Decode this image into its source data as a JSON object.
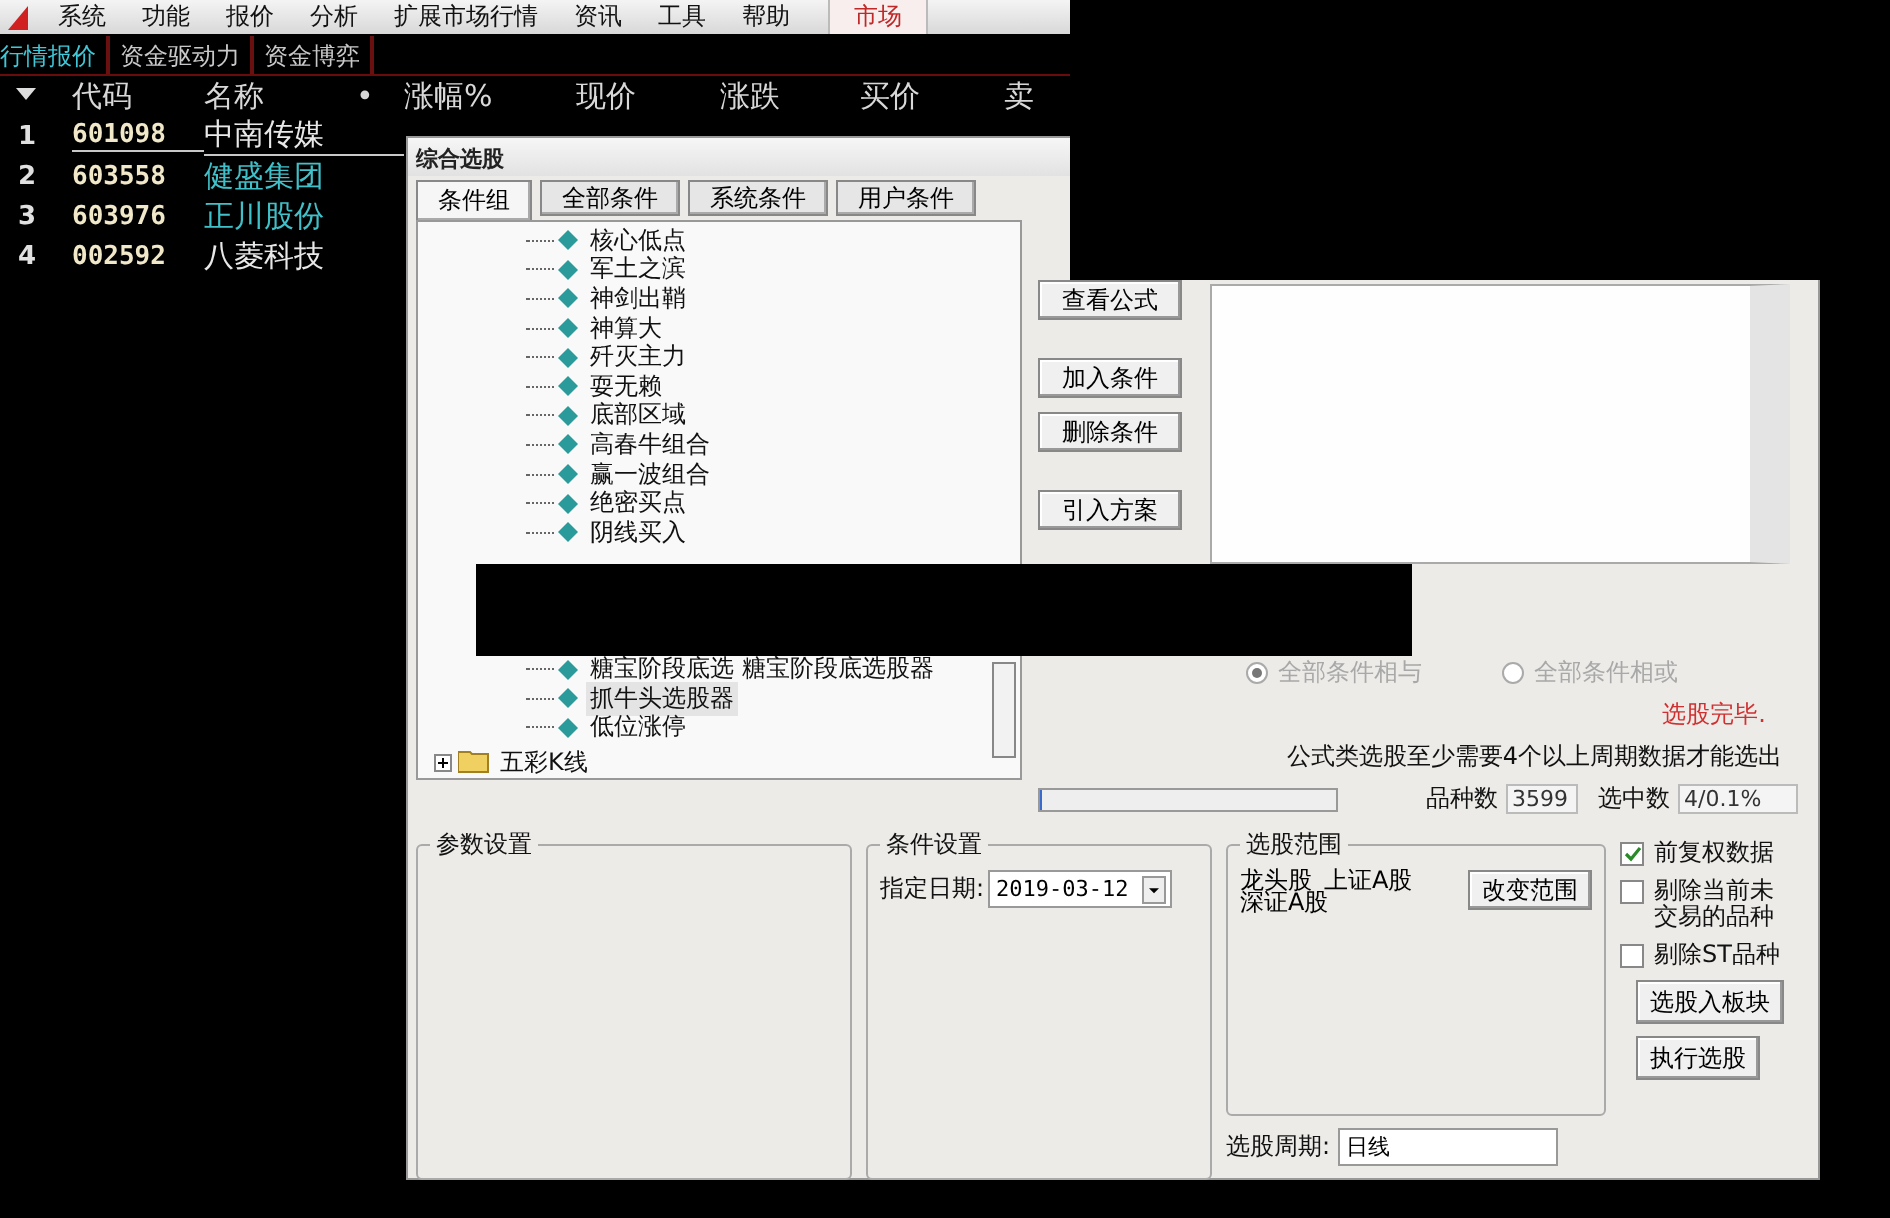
{
  "menu": [
    {
      "label": "系统"
    },
    {
      "label": "功能"
    },
    {
      "label": "报价"
    },
    {
      "label": "分析"
    },
    {
      "label": "扩展市场行情"
    },
    {
      "label": "资讯"
    },
    {
      "label": "工具"
    },
    {
      "label": "帮助"
    }
  ],
  "market_tab": {
    "label": "市场",
    "selected": true
  },
  "sub_tabs": [
    {
      "label": "行情报价",
      "selected": true
    },
    {
      "label": "资金驱动力",
      "selected": false
    },
    {
      "label": "资金博弈",
      "selected": false
    }
  ],
  "table": {
    "columns": [
      "代码",
      "名称",
      "•",
      "涨幅%",
      "现价",
      "涨跌",
      "买价",
      "卖"
    ],
    "rows": [
      {
        "index": "1",
        "code": "601098",
        "name": "中南传媒",
        "color": "#e8e8e8",
        "selected": true
      },
      {
        "index": "2",
        "code": "603558",
        "name": "健盛集团",
        "color": "#40c0c8",
        "selected": false
      },
      {
        "index": "3",
        "code": "603976",
        "name": "正川股份",
        "color": "#40c0c8",
        "selected": false
      },
      {
        "index": "4",
        "code": "002592",
        "name": "八菱科技",
        "color": "#e8e8e8",
        "selected": false
      }
    ]
  },
  "dialog": {
    "title": "综合选股",
    "tabs": [
      {
        "label": "条件组",
        "selected": true
      },
      {
        "label": "全部条件",
        "selected": false
      },
      {
        "label": "系统条件",
        "selected": false
      },
      {
        "label": "用户条件",
        "selected": false
      }
    ],
    "tree": {
      "leaves_top": [
        {
          "label": "核心低点",
          "selected": false
        },
        {
          "label": "军土之滨",
          "selected": false
        },
        {
          "label": "神剑出鞘",
          "selected": false
        },
        {
          "label": "神算大",
          "selected": false
        },
        {
          "label": "歼灭主力",
          "selected": false
        },
        {
          "label": "耍无赖",
          "selected": false
        },
        {
          "label": "底部区域",
          "selected": false
        },
        {
          "label": "高春牛组合",
          "selected": false
        },
        {
          "label": "赢一波组合",
          "selected": false
        },
        {
          "label": "绝密买点",
          "selected": false
        },
        {
          "label": "阴线买入",
          "selected": false
        }
      ],
      "leaves_bottom": [
        {
          "label": "糖宝阶段底选  糖宝阶段底选股器",
          "selected": false
        },
        {
          "label": "抓牛头选股器",
          "selected": true
        },
        {
          "label": "低位涨停",
          "selected": false
        }
      ],
      "folders": [
        {
          "label": "五彩K线",
          "expanded": false
        }
      ]
    },
    "side_buttons": [
      "查看公式",
      "加入条件",
      "删除条件",
      "引入方案"
    ],
    "logic": {
      "disabled": true,
      "options": [
        {
          "label": "全部条件相与",
          "selected": true
        },
        {
          "label": "全部条件相或",
          "selected": false
        }
      ]
    },
    "status": "选股完毕.",
    "note": "公式类选股至少需要4个以上周期数据才能选出",
    "progress": {
      "level": 0
    },
    "count_label": "品种数",
    "count_value": "3599",
    "hit_label": "选中数",
    "hit_value": "4/0.1%",
    "params_group": {
      "title": "参数设置"
    },
    "condition_group": {
      "title": "条件设置",
      "date_label": "指定日期:",
      "date_value": "2019-03-12"
    },
    "scope_group": {
      "title": "选股范围",
      "items": [
        "龙头股",
        "上证A股",
        "深证A股"
      ],
      "button": "改变范围"
    },
    "period": {
      "label": "选股周期:",
      "value": "日线"
    },
    "options": [
      {
        "label": "前复权数据",
        "checked": true
      },
      {
        "label": "剔除当前未交易的品种",
        "checked": false
      },
      {
        "label": "剔除ST品种",
        "checked": false
      }
    ],
    "action_buttons": [
      "选股入板块",
      "执行选股"
    ]
  }
}
